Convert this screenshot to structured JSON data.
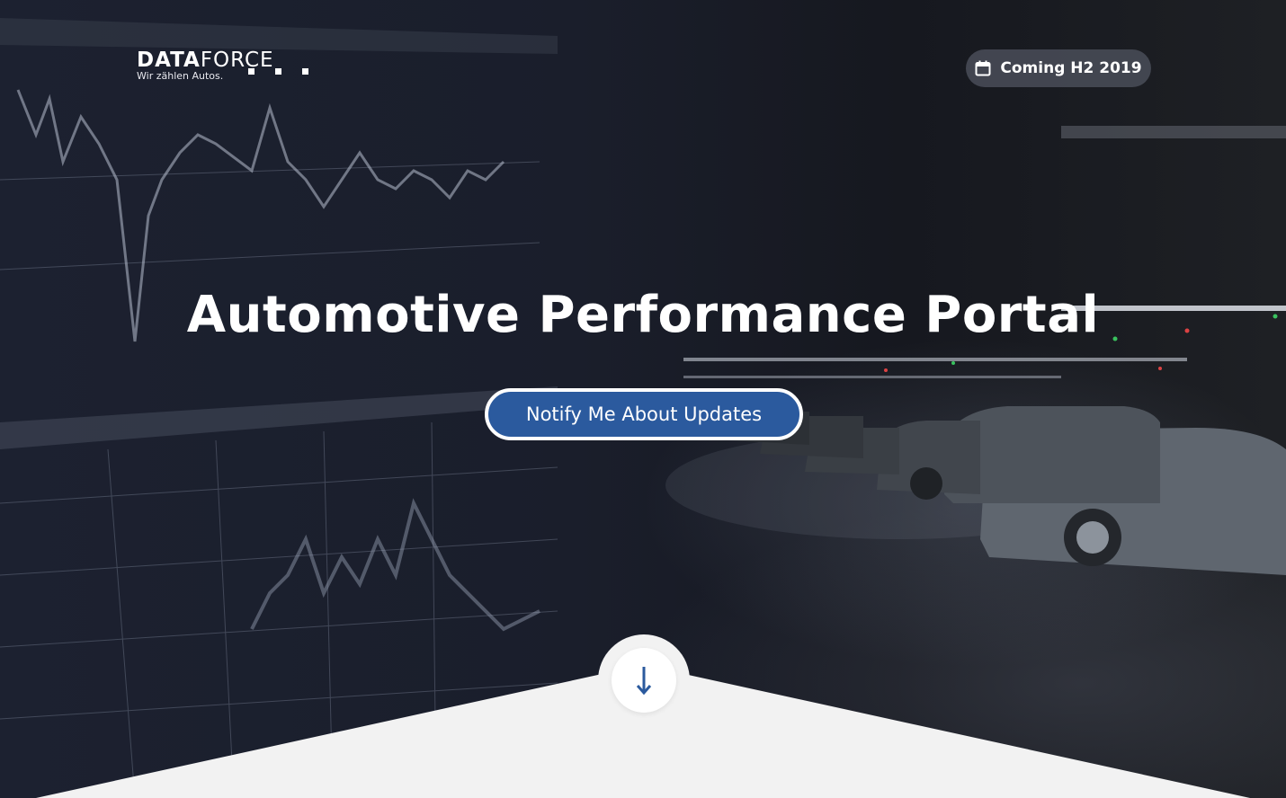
{
  "brand": {
    "name_bold": "DATA",
    "name_light": "FORCE",
    "tagline": "Wir zählen Autos."
  },
  "badge": {
    "icon": "calendar-icon",
    "label": "Coming H2 2019"
  },
  "hero": {
    "title": "Automotive Performance Portal",
    "cta_label": "Notify Me About Updates",
    "scroll_icon": "arrow-down-icon"
  },
  "colors": {
    "accent": "#2b5a9e",
    "background": "#1b1f2b",
    "footer": "#f2f2f2",
    "text": "#ffffff"
  }
}
